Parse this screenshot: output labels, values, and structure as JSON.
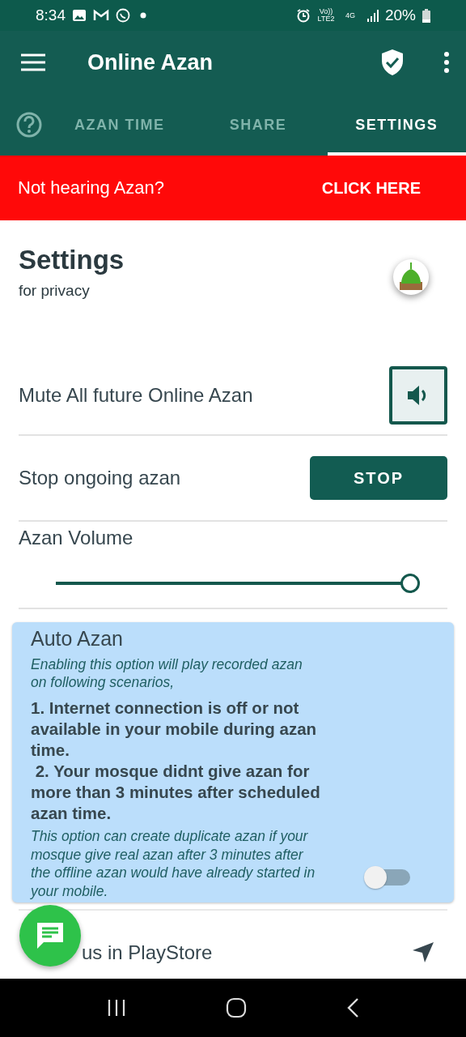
{
  "status_bar": {
    "time": "8:34",
    "network": "Vo)) LTE2",
    "data": "4G",
    "battery": "20%"
  },
  "app_bar": {
    "title": "Online Azan"
  },
  "tabs": [
    {
      "label": "AZAN TIME",
      "selected": false
    },
    {
      "label": "SHARE",
      "selected": false
    },
    {
      "label": "SETTINGS",
      "selected": true
    }
  ],
  "banner": {
    "text": "Not hearing Azan?",
    "action": "CLICK HERE"
  },
  "settings": {
    "title": "Settings",
    "subtitle": "for privacy"
  },
  "mute": {
    "label": "Mute All future Online Azan",
    "muted": false
  },
  "stop": {
    "label": "Stop ongoing azan",
    "button": "STOP"
  },
  "volume": {
    "label": "Azan Volume",
    "level": 1.0
  },
  "auto_azan": {
    "title": "Auto Azan",
    "intro": "Enabling this option will play recorded azan on following scenarios,",
    "scenarios": [
      "1. Internet connection is off or not available in your mobile during azan time.",
      "2. Your mosque didnt give azan for more than 3 minutes after scheduled azan time."
    ],
    "note": "This option can create duplicate azan if your mosque give real azan after 3 minutes after the offline azan would have already started in your mobile.",
    "on": false
  },
  "rate": {
    "label": "us in PlayStore"
  }
}
